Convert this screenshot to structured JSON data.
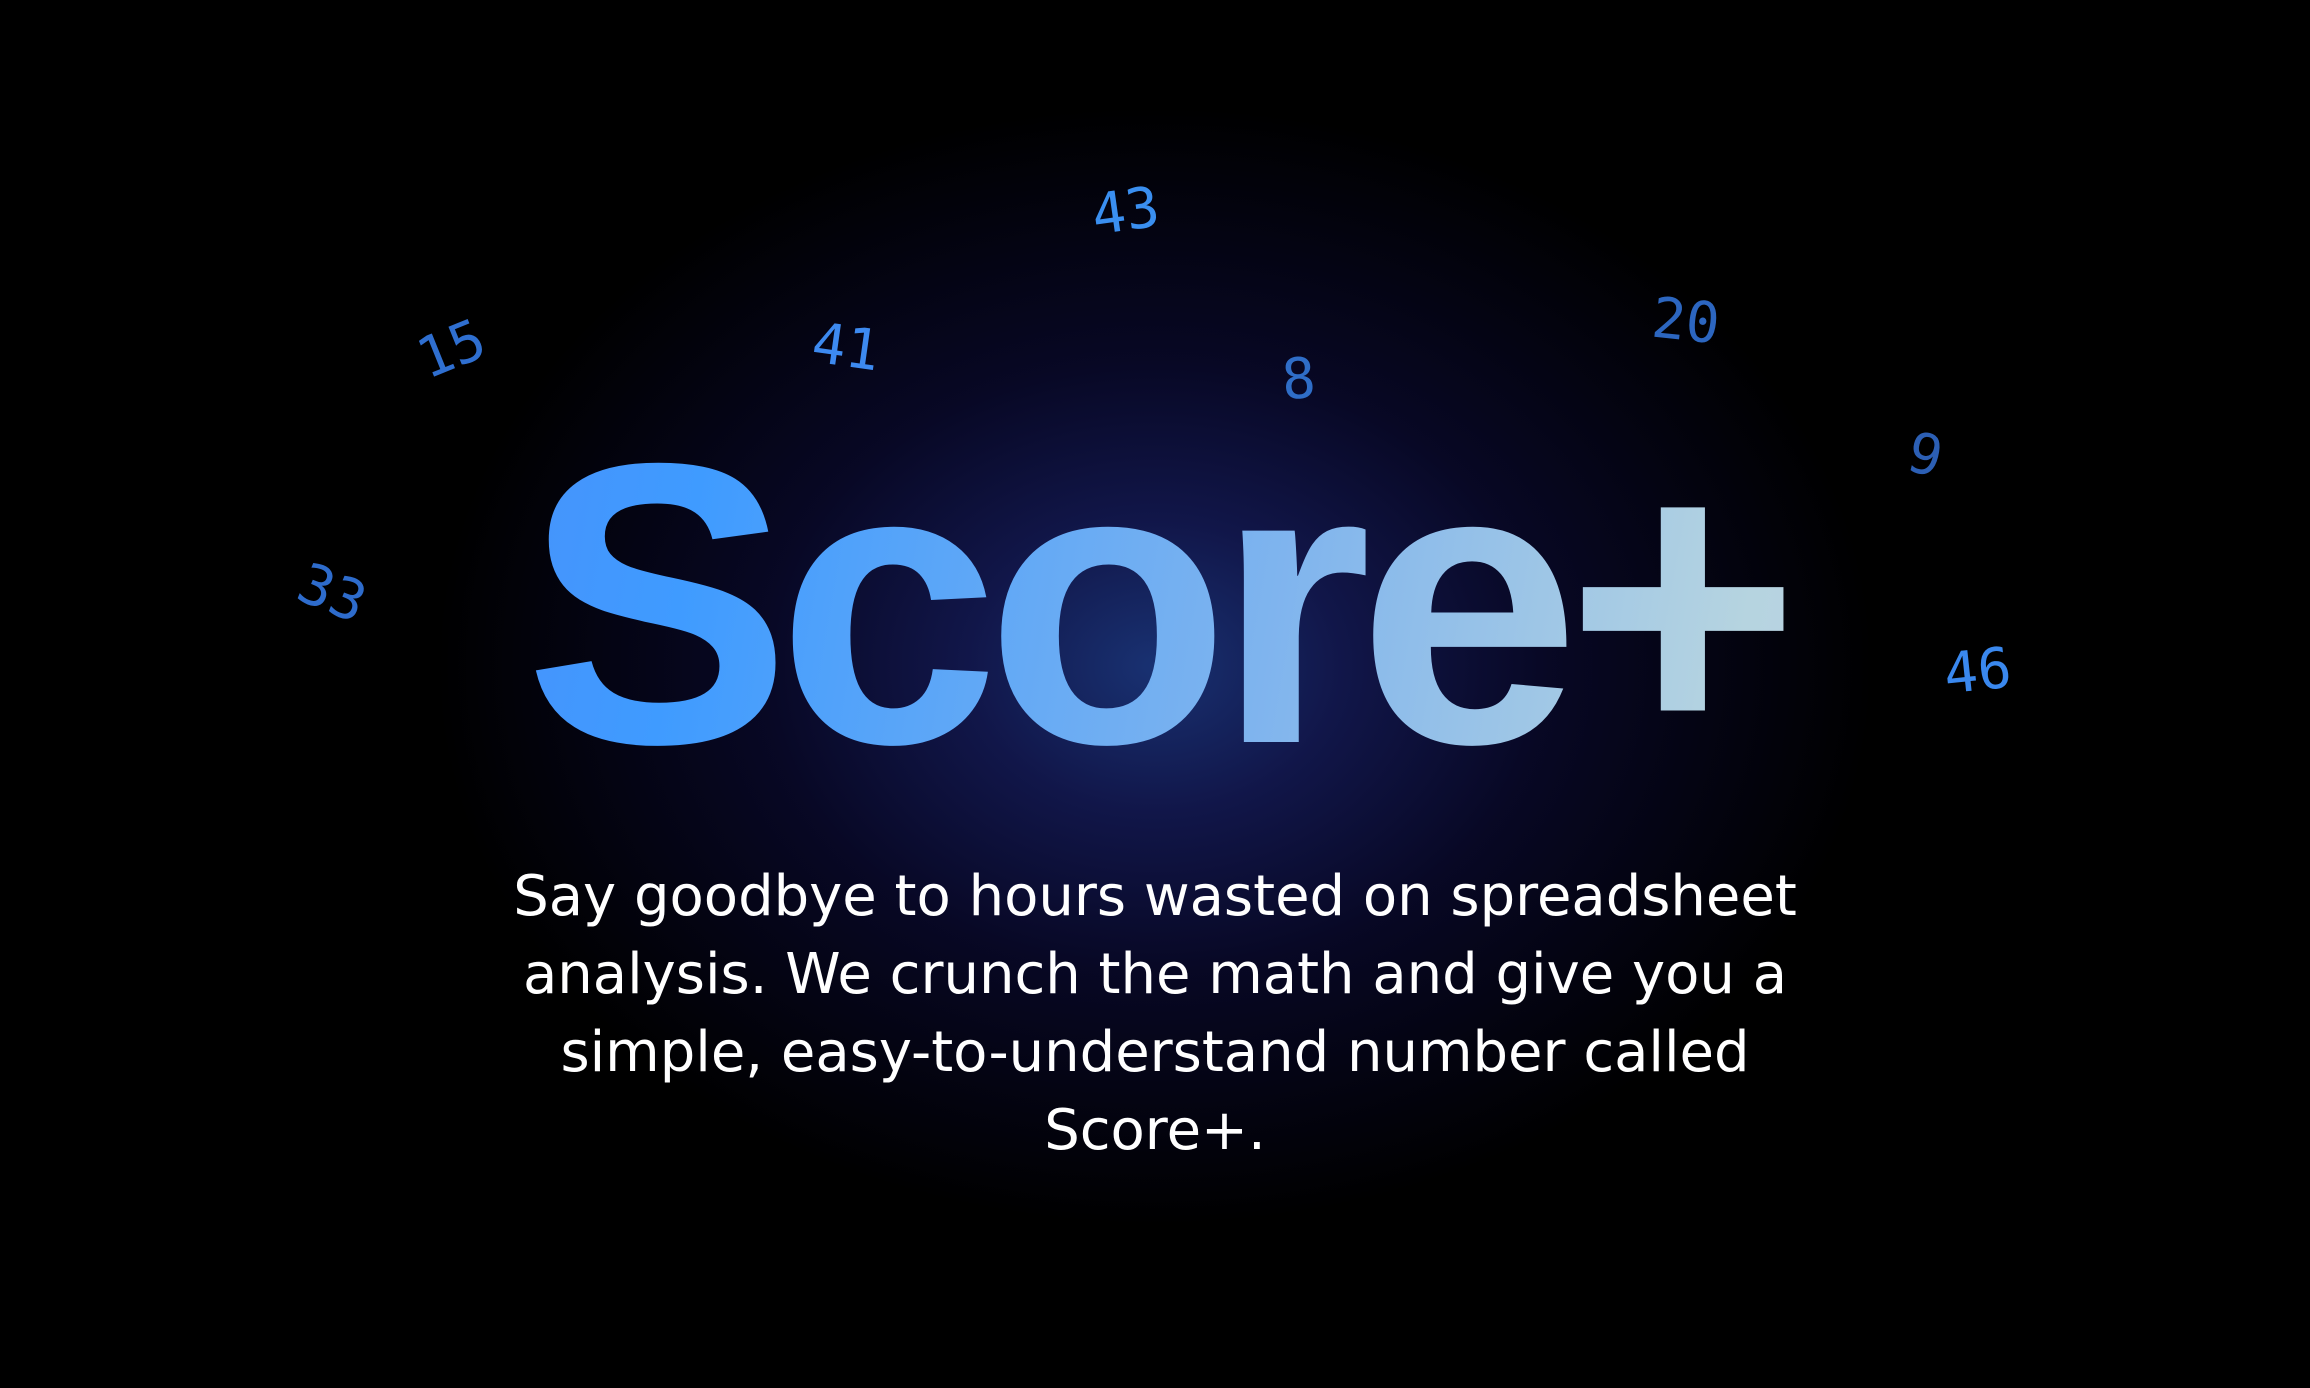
{
  "hero": {
    "title": "Score+",
    "tagline": "Say goodbye to hours wasted on spreadsheet analysis. We crunch the math and give you a simple, easy-to-understand number called Score+."
  },
  "floating_numbers": {
    "n1": "43",
    "n2": "15",
    "n3": "41",
    "n4": "8",
    "n5": "20",
    "n6": "9",
    "n7": "33",
    "n8": "46"
  },
  "colors": {
    "background": "#000000",
    "glow": "#1a3478",
    "number_blue": "#3d86e6",
    "title_gradient_start": "#5a7ef2",
    "title_gradient_mid": "#3f9bff",
    "title_gradient_end": "#cdc2f6",
    "tagline": "#ffffff"
  }
}
